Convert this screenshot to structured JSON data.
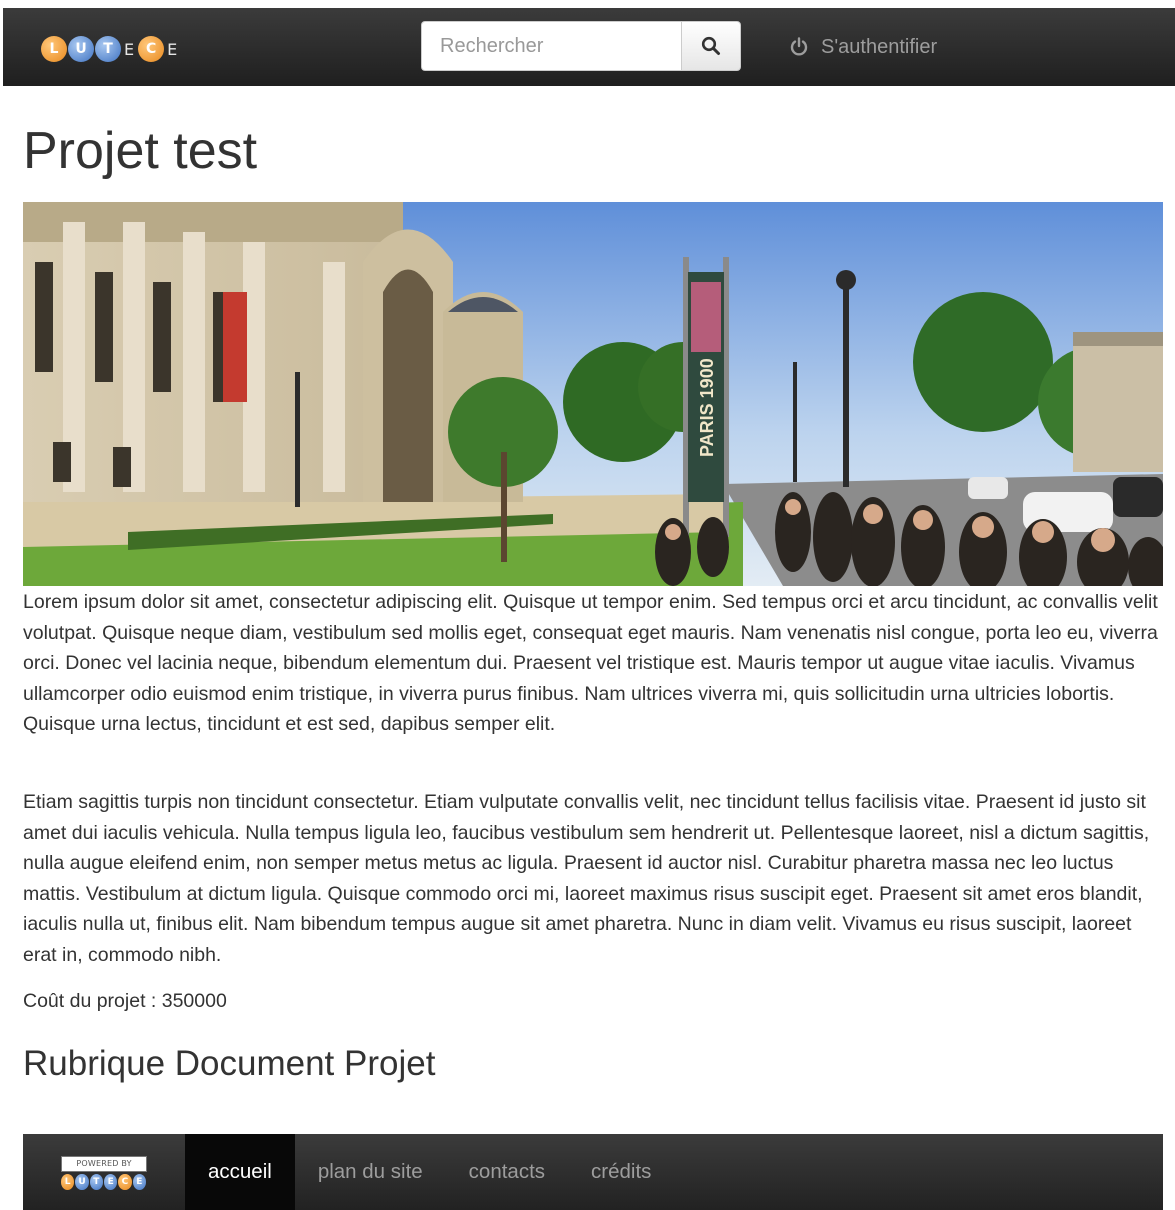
{
  "header": {
    "logo_letters": [
      "L",
      "U",
      "T",
      "E",
      "C",
      "E"
    ],
    "search": {
      "placeholder": "Rechercher",
      "value": ""
    },
    "login_label": "S'authentifier"
  },
  "main": {
    "title": "Projet test",
    "paragraphs": [
      "Lorem ipsum dolor sit amet, consectetur adipiscing elit. Quisque ut tempor enim. Sed tempus orci et arcu tincidunt, ac convallis velit volutpat. Quisque neque diam, vestibulum sed mollis eget, consequat eget mauris. Nam venenatis nisl congue, porta leo eu, viverra orci. Donec vel lacinia neque, bibendum elementum dui. Praesent vel tristique est. Mauris tempor ut augue vitae iaculis. Vivamus ullamcorper odio euismod enim tristique, in viverra purus finibus. Nam ultrices viverra mi, quis sollicitudin urna ultricies lobortis. Quisque urna lectus, tincidunt et est sed, dapibus semper elit.",
      "Etiam sagittis turpis non tincidunt consectetur. Etiam vulputate convallis velit, nec tincidunt tellus facilisis vitae. Praesent id justo sit amet dui iaculis vehicula. Nulla tempus ligula leo, faucibus vestibulum sem hendrerit ut. Pellentesque laoreet, nisl a dictum sagittis, nulla augue eleifend enim, non semper metus metus ac ligula. Praesent id auctor nisl. Curabitur pharetra massa nec leo luctus mattis. Vestibulum at dictum ligula. Quisque commodo orci mi, laoreet maximus risus suscipit eget. Praesent sit amet eros blandit, iaculis nulla ut, finibus elit. Nam bibendum tempus augue sit amet pharetra. Nunc in diam velit. Vivamus eu risus suscipit, laoreet erat in, commodo nibh."
    ],
    "cost_text": "Coût du projet : 350000",
    "section_title": "Rubrique Document Projet",
    "banner_text": "PARIS 1900"
  },
  "footer": {
    "powered_by": "POWERED BY",
    "logo_letters": [
      "L",
      "U",
      "T",
      "E",
      "C",
      "E"
    ],
    "nav": [
      {
        "label": "accueil",
        "active": true
      },
      {
        "label": "plan du site",
        "active": false
      },
      {
        "label": "contacts",
        "active": false
      },
      {
        "label": "crédits",
        "active": false
      }
    ]
  },
  "colors": {
    "navbar": "#222222",
    "nav_text": "#9d9d9d",
    "active_nav_bg": "#080808",
    "logo_orange": "#e8891e",
    "logo_blue": "#3f73c2",
    "body_text": "#333333"
  },
  "icons": {
    "search": "search-icon",
    "login": "power-icon"
  }
}
